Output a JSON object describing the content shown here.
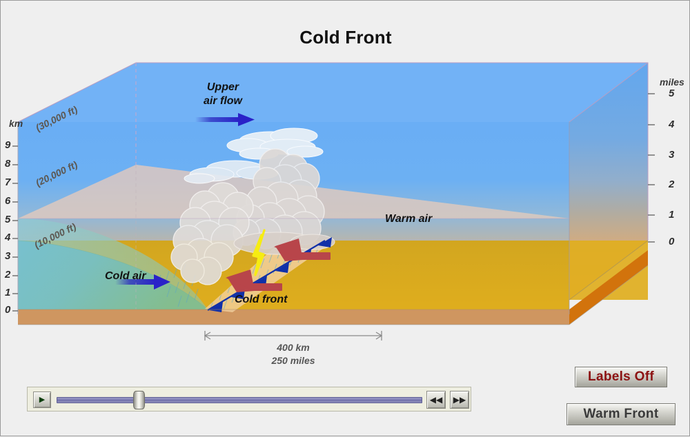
{
  "page": {
    "title": "Cold Front",
    "background": "#efefef"
  },
  "axes": {
    "left": {
      "unit_label": "km",
      "ticks": [
        "9",
        "8",
        "7",
        "6",
        "5",
        "4",
        "3",
        "2",
        "1",
        "0"
      ]
    },
    "right": {
      "unit_label": "miles",
      "ticks": [
        "5",
        "4",
        "3",
        "2",
        "1",
        "0"
      ]
    },
    "altitude_annotations": [
      "(30,000 ft)",
      "(20,000 ft)",
      "(10,000 ft)"
    ]
  },
  "scene": {
    "upper_air_flow": "Upper\nair flow",
    "upper_air_flow_line1": "Upper",
    "upper_air_flow_line2": "air flow",
    "warm_air": "Warm air",
    "cold_air": "Cold air",
    "cold_front": "Cold  front"
  },
  "scalebar": {
    "km": "400 km",
    "miles": "250 miles"
  },
  "controls": {
    "play_icon": "play-icon",
    "rewind_icon": "rewind-icon",
    "forward_icon": "fast-forward-icon",
    "play_glyph": "▶",
    "rewind_glyph": "◀◀",
    "forward_glyph": "▶▶",
    "labels_button": "Labels Off",
    "warm_front_button": "Warm Front",
    "slider_position_percent": 21
  },
  "colors": {
    "sky_top": "#6aaef5",
    "sky_mid": "#9bb6c8",
    "sky_low": "#f5b95a",
    "ground_plane": "#dcab20",
    "ground_base": "#cf9660",
    "ground_base_side": "#d2730c",
    "cold_air": "#67b3ab",
    "front_arrow": "#b8454a",
    "flow_arrow": "#2a2ac0",
    "pennant": "#1030a8",
    "lightning": "#f6ec12",
    "labels_text": "#8c1212"
  }
}
